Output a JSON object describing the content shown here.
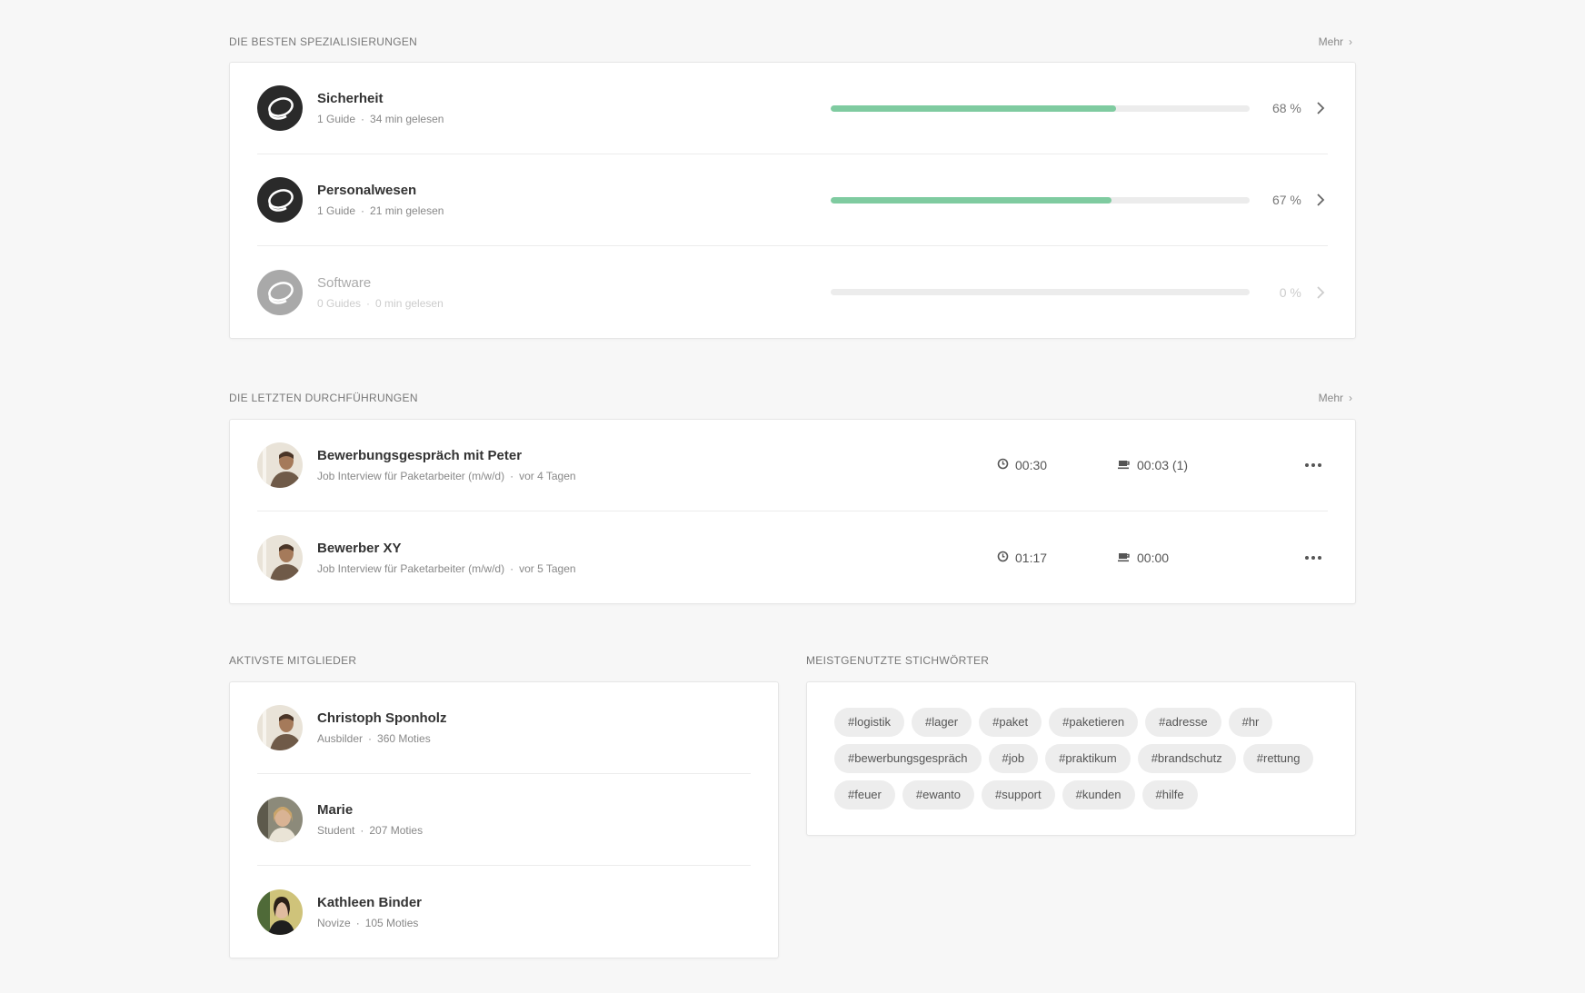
{
  "specializations": {
    "title": "DIE BESTEN SPEZIALISIERUNGEN",
    "more": "Mehr",
    "items": [
      {
        "name": "Sicherheit",
        "guides": "1 Guide",
        "read": "34 min gelesen",
        "progress": 68,
        "percent_label": "68 %"
      },
      {
        "name": "Personalwesen",
        "guides": "1 Guide",
        "read": "21 min gelesen",
        "progress": 67,
        "percent_label": "67 %"
      },
      {
        "name": "Software",
        "guides": "0 Guides",
        "read": "0 min gelesen",
        "progress": 0,
        "percent_label": "0 %"
      }
    ]
  },
  "runs": {
    "title": "DIE LETZTEN DURCHFÜHRUNGEN",
    "more": "Mehr",
    "items": [
      {
        "title": "Bewerbungsgespräch mit Peter",
        "guide": "Job Interview für Paketarbeiter (m/w/d)",
        "when": "vor 4 Tagen",
        "duration": "00:30",
        "break": "00:03 (1)"
      },
      {
        "title": "Bewerber XY",
        "guide": "Job Interview für Paketarbeiter (m/w/d)",
        "when": "vor 5 Tagen",
        "duration": "01:17",
        "break": "00:00"
      }
    ]
  },
  "members": {
    "title": "AKTIVSTE MITGLIEDER",
    "items": [
      {
        "name": "Christoph Sponholz",
        "role": "Ausbilder",
        "moties": "360 Moties"
      },
      {
        "name": "Marie",
        "role": "Student",
        "moties": "207 Moties"
      },
      {
        "name": "Kathleen Binder",
        "role": "Novize",
        "moties": "105 Moties"
      }
    ]
  },
  "keywords": {
    "title": "MEISTGENUTZTE STICHWÖRTER",
    "tags": [
      "#logistik",
      "#lager",
      "#paket",
      "#paketieren",
      "#adresse",
      "#hr",
      "#bewerbungsgespräch",
      "#job",
      "#praktikum",
      "#brandschutz",
      "#rettung",
      "#feuer",
      "#ewanto",
      "#support",
      "#kunden",
      "#hilfe"
    ]
  },
  "colors": {
    "progress": "#7fcba0",
    "track": "#ececec",
    "background": "#f7f7f7"
  },
  "icons": {
    "spec_logo": "swirl-logo-icon",
    "clock": "clock-icon",
    "coffee": "coffee-cup-icon",
    "chevron": "chevron-right-icon",
    "more": "more-dots-icon"
  }
}
